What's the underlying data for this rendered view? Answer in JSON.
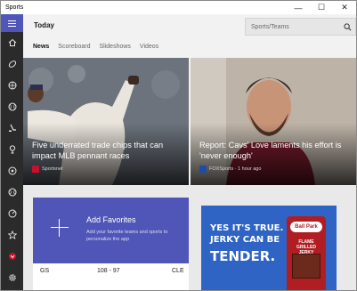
{
  "window": {
    "app_name": "Sports",
    "minimize": "—",
    "maximize": "☐",
    "close": "✕"
  },
  "rail": {
    "items": [
      {
        "icon": "home-icon"
      },
      {
        "icon": "football-icon"
      },
      {
        "icon": "basketball-icon"
      },
      {
        "icon": "baseball-icon"
      },
      {
        "icon": "hockey-icon"
      },
      {
        "icon": "golf-icon"
      },
      {
        "icon": "soccer-icon"
      },
      {
        "icon": "tennis-icon"
      },
      {
        "icon": "racing-icon"
      },
      {
        "icon": "star-icon"
      },
      {
        "icon": "team-logo-icon"
      },
      {
        "icon": "settings-icon"
      }
    ]
  },
  "header": {
    "title": "Today",
    "search_placeholder": "Sports/Teams"
  },
  "tabs": [
    {
      "label": "News",
      "active": true
    },
    {
      "label": "Scoreboard",
      "active": false
    },
    {
      "label": "Slideshows",
      "active": false
    },
    {
      "label": "Videos",
      "active": false
    }
  ],
  "stories": [
    {
      "headline": "Five underrated trade chips that can impact MLB pennant races",
      "source": "Sportsnet",
      "source_color": "#c8102e"
    },
    {
      "headline": "Report: Cavs' Love laments his effort is 'never enough'",
      "source": "FOXSports · 1 hour ago",
      "source_color": "#1f4aa8"
    }
  ],
  "favorites": {
    "title": "Add Favorites",
    "description": "Add your favorite teams and sports to personalize the app"
  },
  "scoreboard": {
    "home": "GS",
    "score": "108 - 97",
    "away": "CLE"
  },
  "ad": {
    "line1": "YES IT'S TRUE.",
    "line2": "JERKY CAN BE",
    "line3": "TENDER.",
    "brand": "Ball Park",
    "product": "FLAME GRILLED JERKY",
    "colors": {
      "background": "#2f64c4",
      "pack": "#b01e23"
    }
  },
  "colors": {
    "accent": "#4f56b7",
    "rail": "#2b2b2b"
  }
}
